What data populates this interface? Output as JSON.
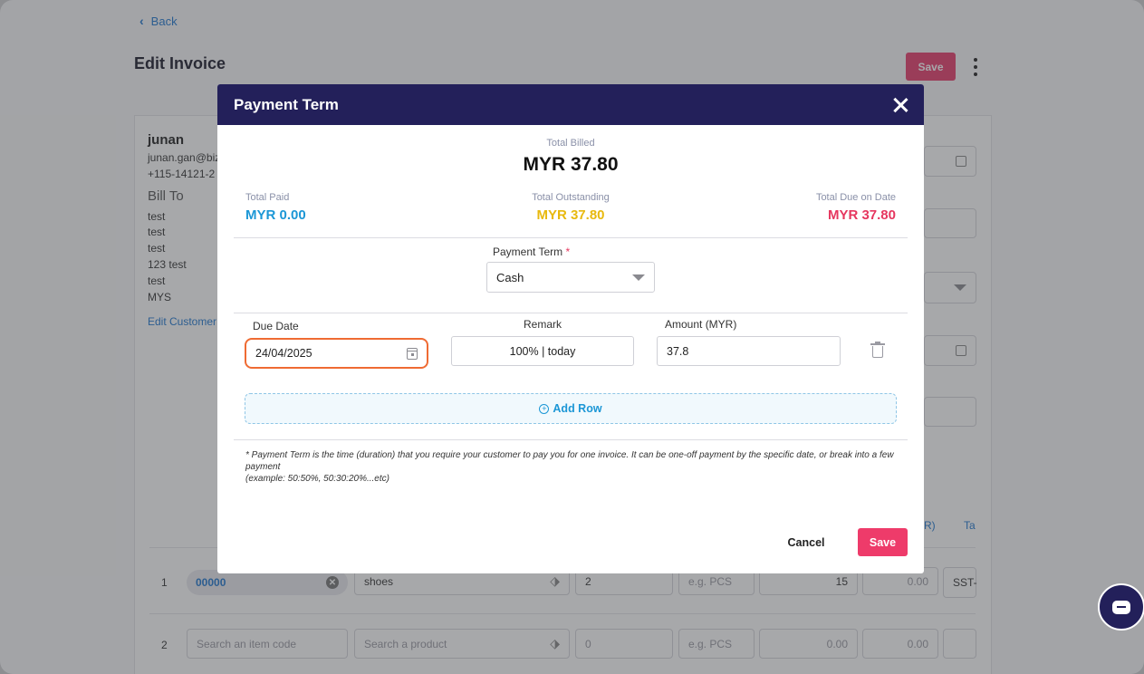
{
  "background": {
    "back_label": "Back",
    "page_title": "Edit Invoice",
    "save_label": "Save",
    "customer": {
      "name": "junan",
      "email": "junan.gan@biz",
      "phone": "+115-14121-2",
      "bill_to_label": "Bill To",
      "address_lines": [
        "test",
        "test",
        "test",
        "123 test",
        "test",
        "MYS"
      ],
      "edit_label": "Edit Customer"
    },
    "table_headers": [
      "R)",
      "Ta"
    ],
    "rows": [
      {
        "num": "1",
        "code": "00000",
        "product": "shoes",
        "qty": "2",
        "uom": "e.g. PCS",
        "price": "15",
        "discount": "0.00",
        "tax": "SST-"
      },
      {
        "num": "2",
        "code": "Search an item code",
        "product": "Search a product",
        "qty": "0",
        "uom": "e.g. PCS",
        "price": "0.00",
        "discount": "0.00",
        "tax": ""
      }
    ]
  },
  "modal": {
    "title": "Payment Term",
    "total_billed_label": "Total Billed",
    "total_billed_value": "MYR 37.80",
    "summary": {
      "paid_label": "Total Paid",
      "paid_value": "MYR 0.00",
      "outstanding_label": "Total Outstanding",
      "outstanding_value": "MYR 37.80",
      "due_label": "Total Due on Date",
      "due_value": "MYR 37.80"
    },
    "payment_term_label": "Payment Term",
    "payment_term_required": "*",
    "payment_term_value": "Cash",
    "columns": {
      "due_date": "Due Date",
      "remark": "Remark",
      "amount": "Amount (MYR)"
    },
    "row": {
      "due_date": "24/04/2025",
      "remark": "100% |  today",
      "amount": "37.8"
    },
    "add_row_label": "Add Row",
    "note_line1": "* Payment Term is the time (duration) that you require your customer to pay you for one invoice. It can be one-off payment by the specific date, or break into a few payment",
    "note_line2": "(example: 50:50%, 50:30:20%...etc)",
    "cancel_label": "Cancel",
    "save_label": "Save"
  },
  "colors": {
    "header_navy": "#23205a",
    "paid_blue": "#1c97d6",
    "outstanding_yellow": "#e8b90e",
    "due_pink": "#e6375f",
    "save_pink": "#ee3b6a",
    "focus_orange": "#ef6b33"
  }
}
